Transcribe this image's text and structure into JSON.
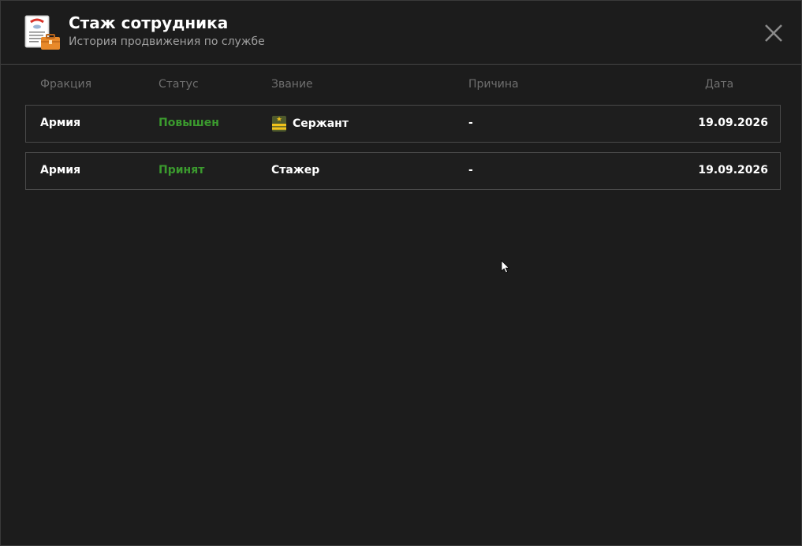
{
  "header": {
    "title": "Стаж сотрудника",
    "subtitle": "История продвижения по службе",
    "icon": "document-briefcase-icon"
  },
  "table": {
    "columns": {
      "faction": "Фракция",
      "status": "Статус",
      "rank": "Звание",
      "reason": "Причина",
      "date": "Дата"
    },
    "rows": [
      {
        "faction": "Армия",
        "status": "Повышен",
        "rank": "Сержант",
        "rank_icon": "sergeant-insignia-icon",
        "reason": "-",
        "date": "19.09.2026"
      },
      {
        "faction": "Армия",
        "status": "Принят",
        "rank": "Стажер",
        "reason": "-",
        "date": "19.09.2026"
      }
    ]
  },
  "colors": {
    "background": "#1c1c1c",
    "status_green": "#3b9a2e",
    "header_text": "#ffffff",
    "muted_text": "#6f6f6f"
  }
}
